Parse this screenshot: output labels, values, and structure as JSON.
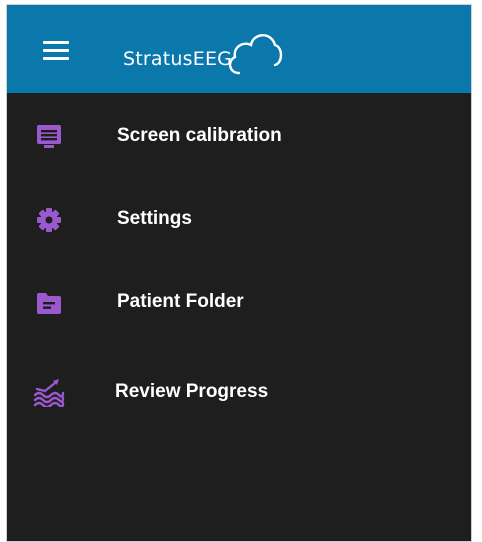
{
  "header": {
    "brand": "StratusEEG",
    "menu_icon": "hamburger-icon",
    "color": "#0a78ab"
  },
  "menu": {
    "accent_color": "#9b59d0",
    "items": [
      {
        "label": "Screen calibration",
        "icon": "monitor-icon"
      },
      {
        "label": "Settings",
        "icon": "gear-icon"
      },
      {
        "label": "Patient Folder",
        "icon": "folder-icon"
      },
      {
        "label": "Review Progress",
        "icon": "review-waves-icon"
      }
    ]
  }
}
